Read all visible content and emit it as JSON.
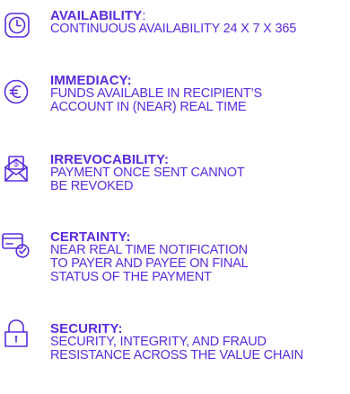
{
  "features": [
    {
      "icon": "clock-icon",
      "title": "AVAILABILITY",
      "title_suffix": ":",
      "lines": [
        "CONTINUOUS AVAILABILITY 24 X 7 X 365"
      ]
    },
    {
      "icon": "euro-coin-icon",
      "title": "IMMEDIACY:",
      "title_suffix": "",
      "lines": [
        "FUNDS AVAILABLE IN RECIPIENT’S",
        "ACCOUNT IN (NEAR) REAL TIME"
      ]
    },
    {
      "icon": "money-envelope-icon",
      "title": "IRREVOCABILITY:",
      "title_suffix": "",
      "lines": [
        "PAYMENT ONCE SENT CANNOT",
        "BE REVOKED"
      ]
    },
    {
      "icon": "card-check-icon",
      "title": "CERTAINTY:",
      "title_suffix": "",
      "lines": [
        "NEAR REAL TIME NOTIFICATION",
        "TO PAYER AND PAYEE ON FINAL",
        "STATUS OF THE PAYMENT"
      ]
    },
    {
      "icon": "padlock-icon",
      "title": "SECURITY:",
      "title_suffix": "",
      "lines": [
        "SECURITY, INTEGRITY, AND FRAUD",
        "RESISTANCE ACROSS THE VALUE CHAIN"
      ]
    }
  ],
  "colors": {
    "accent": "#5a2be0"
  }
}
